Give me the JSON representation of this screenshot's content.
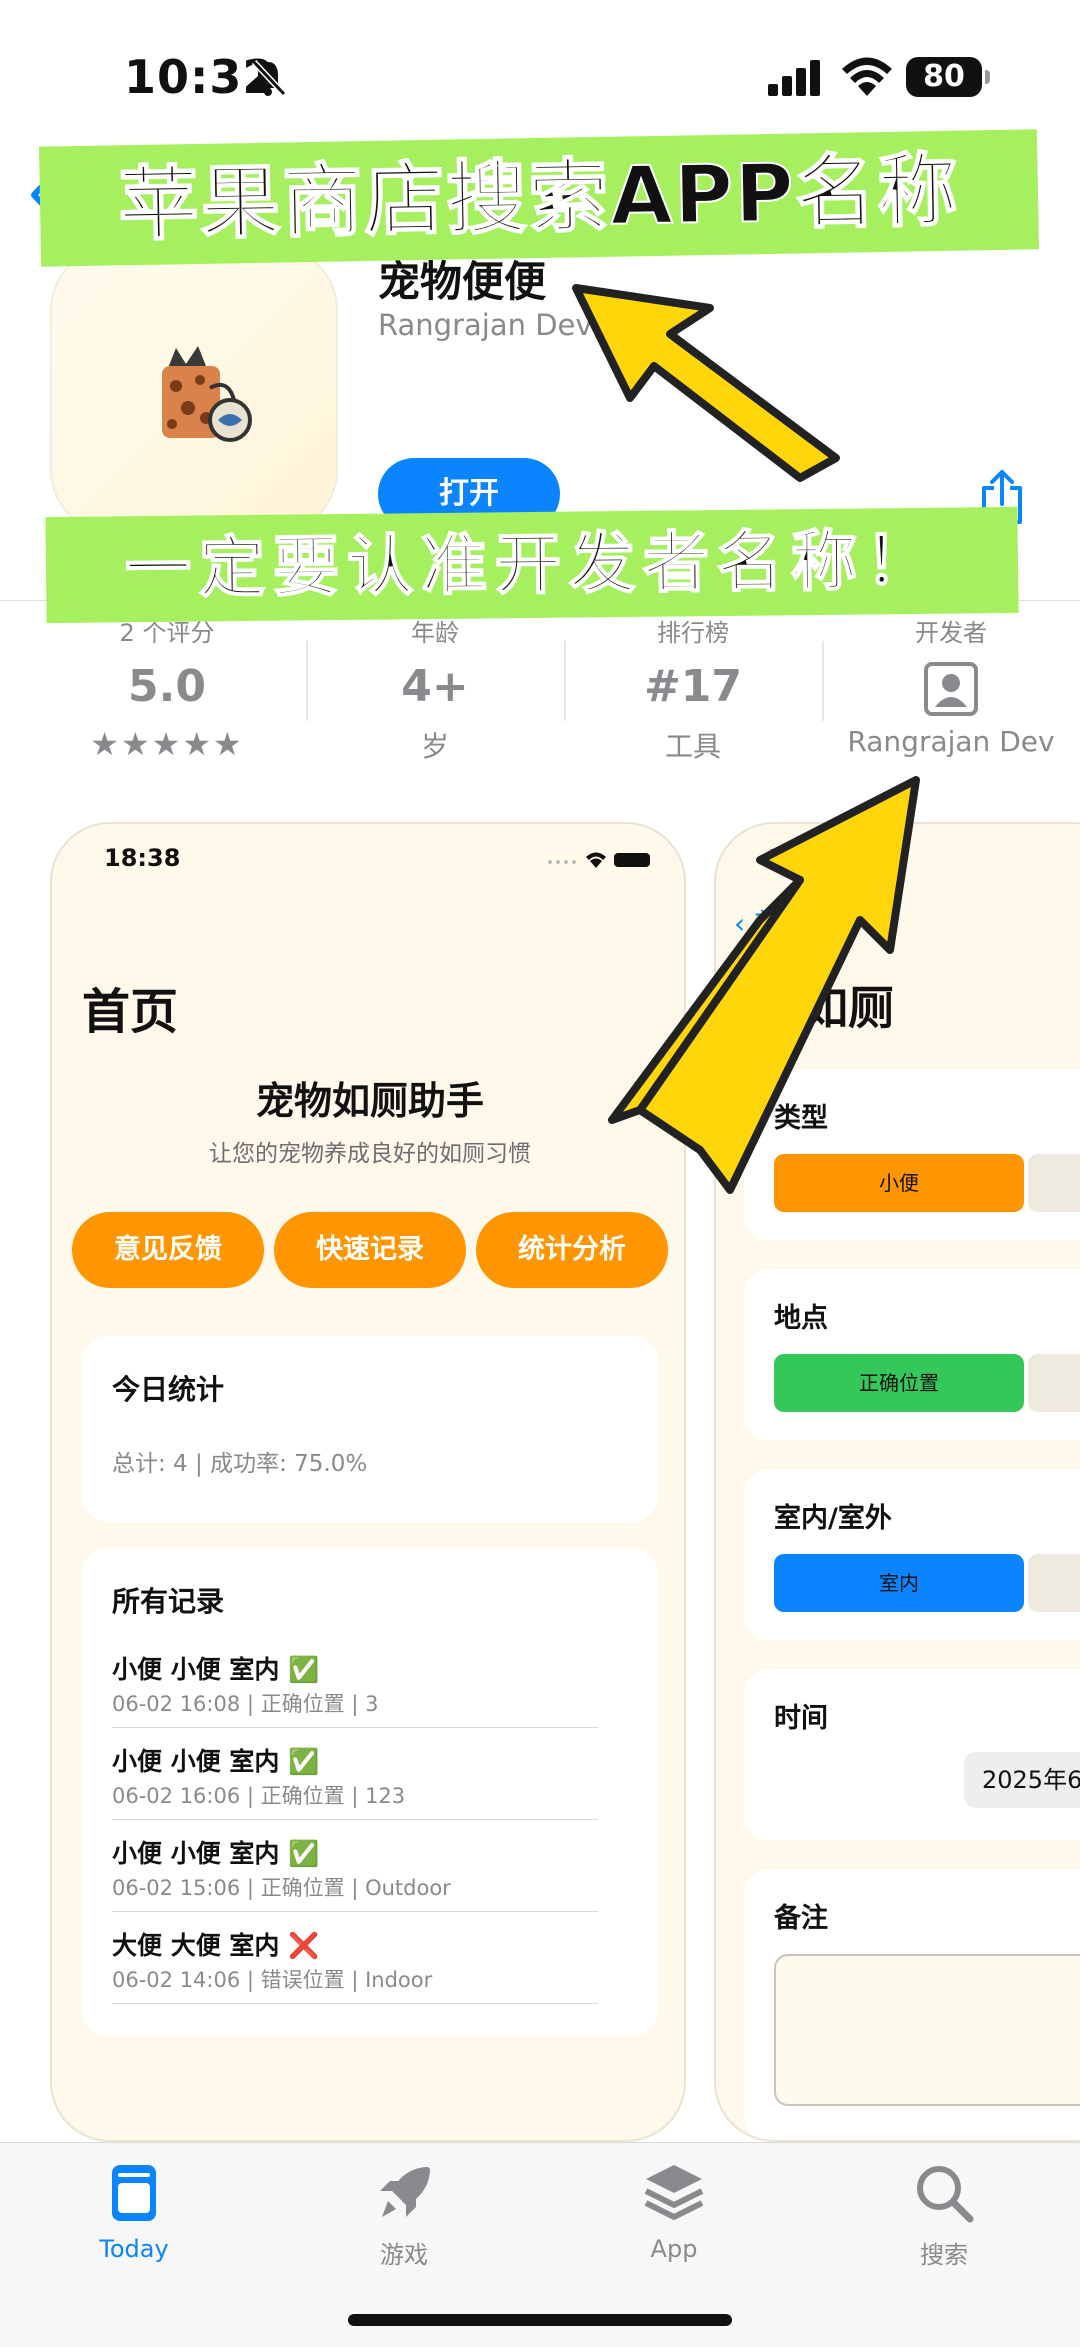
{
  "status_bar": {
    "time": "10:32",
    "battery": "80"
  },
  "app": {
    "name": "宠物便便",
    "developer": "Rangrajan Dev",
    "open_label": "打开"
  },
  "info": {
    "ratings": {
      "label": "2 个评分",
      "value": "5.0",
      "stars": "★★★★★"
    },
    "age": {
      "label": "年龄",
      "value": "4+",
      "sub": "岁"
    },
    "rank": {
      "label": "排行榜",
      "value": "#17",
      "sub": "工具"
    },
    "developer": {
      "label": "开发者",
      "sub": "Rangrajan Dev"
    }
  },
  "annotations": {
    "banner_top": "苹果商店搜索APP名称",
    "banner_mid": "一定要认准开发者名称！",
    "highlight_color": "#a6f060",
    "arrow_color": "#ffd60a"
  },
  "screenshot1": {
    "time": "18:38",
    "title": "首页",
    "heading": "宠物如厕助手",
    "subtitle": "让您的宠物养成良好的如厕习惯",
    "buttons": [
      "意见反馈",
      "快速记录",
      "统计分析"
    ],
    "today": {
      "title": "今日统计",
      "text": "总计: 4 | 成功率: 75.0%"
    },
    "records_title": "所有记录",
    "records": [
      {
        "line1": "小便 小便 室内 ✅",
        "line2": "06-02 16:08 | 正确位置 | 3"
      },
      {
        "line1": "小便 小便 室内 ✅",
        "line2": "06-02 16:06 | 正确位置 | 123"
      },
      {
        "line1": "小便 小便 室内 ✅",
        "line2": "06-02 15:06 | 正确位置 | Outdoor"
      },
      {
        "line1": "大便 大便 室内 ❌",
        "line2": "06-02 14:06 | 错误位置 | Indoor"
      }
    ]
  },
  "screenshot2": {
    "time": "18",
    "back": "首",
    "title": "如厕",
    "type_label": "类型",
    "type_value": "小便",
    "place_label": "地点",
    "place_value": "正确位置",
    "io_label": "室内/室外",
    "io_value": "室内",
    "time_label": "时间",
    "date_value": "2025年6",
    "note_label": "备注"
  },
  "tabbar": {
    "items": [
      {
        "label": "Today",
        "icon": "today-icon"
      },
      {
        "label": "游戏",
        "icon": "rocket-icon"
      },
      {
        "label": "App",
        "icon": "apps-stack-icon"
      },
      {
        "label": "搜索",
        "icon": "search-icon"
      }
    ],
    "active_color": "#0a84ff"
  }
}
